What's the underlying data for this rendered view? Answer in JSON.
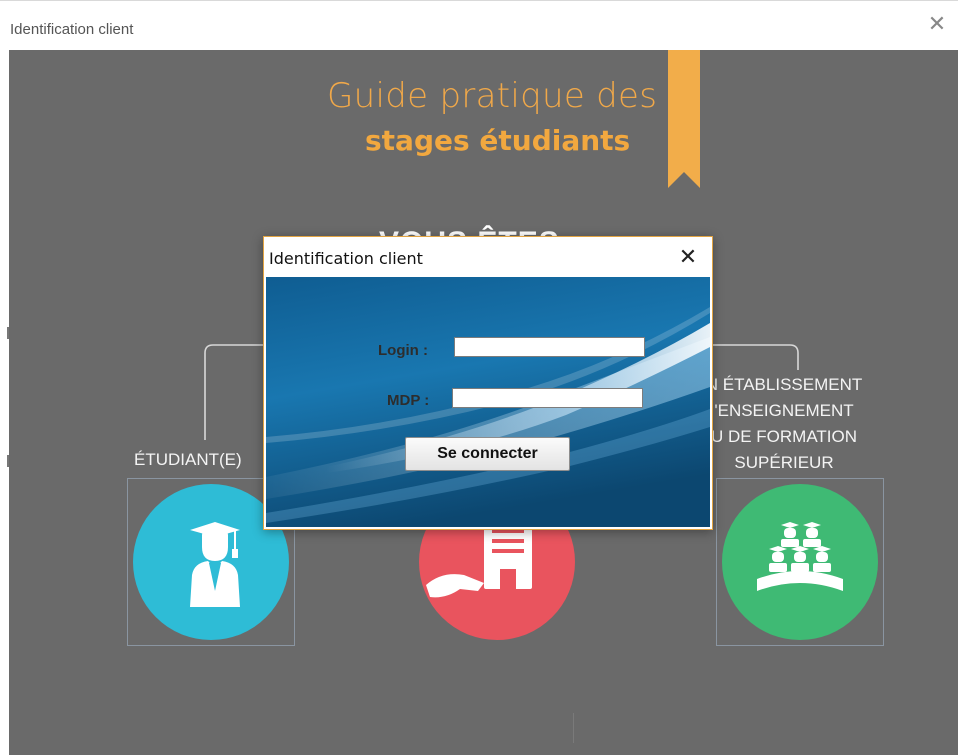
{
  "window": {
    "title": "Identification client",
    "close_icon": "close-icon"
  },
  "background": {
    "guide_line1": "Guide pratique des",
    "guide_line2": "stages étudiants",
    "hidden_heading": "VOUS ÊTES",
    "accent_color": "#f0a849",
    "student_label": "ÉTUDIANT(E)",
    "establishment_label": [
      "N ÉTABLISSEMENT",
      "'ENSEIGNEMENT",
      "U DE FORMATION",
      "SUPÉRIEUR"
    ],
    "tiles": [
      {
        "icon": "student-graduate-icon",
        "color": "#2ebcd6"
      },
      {
        "icon": "company-handshake-icon",
        "color": "#e9545e"
      },
      {
        "icon": "graduates-group-icon",
        "color": "#3fba74"
      }
    ]
  },
  "dialog": {
    "title": "Identification client",
    "close_icon": "close-icon",
    "login_label": "Login :",
    "login_value": "",
    "password_label": "MDP :",
    "password_value": "",
    "submit_label": "Se connecter"
  }
}
